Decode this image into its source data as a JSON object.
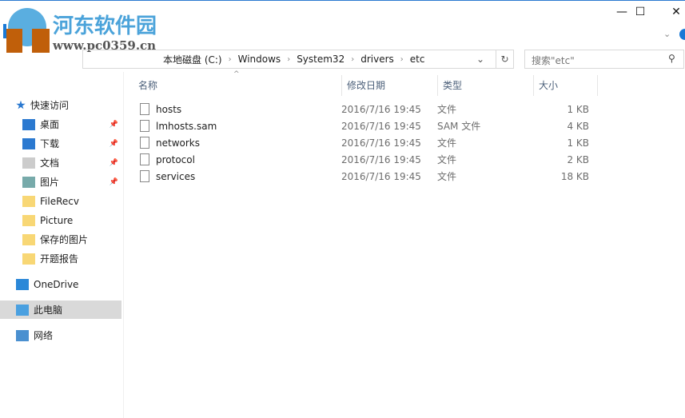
{
  "watermark": {
    "title": "河东软件园",
    "url": "www.pc0359.cn"
  },
  "window": {
    "minimize": "—",
    "maximize": "☐",
    "close": "✕"
  },
  "address": {
    "crumbs": [
      "本地磁盘 (C:)",
      "Windows",
      "System32",
      "drivers",
      "etc"
    ]
  },
  "search": {
    "placeholder": "搜索\"etc\""
  },
  "nav": {
    "items": [
      {
        "label": "快速访问",
        "icon": "star-icon"
      },
      {
        "label": "桌面",
        "icon": "desktop-icon",
        "pinned": true
      },
      {
        "label": "下载",
        "icon": "download-icon",
        "pinned": true
      },
      {
        "label": "文档",
        "icon": "document-icon",
        "pinned": true
      },
      {
        "label": "图片",
        "icon": "picture-icon",
        "pinned": true
      },
      {
        "label": "FileRecv",
        "icon": "folder-icon"
      },
      {
        "label": "Picture",
        "icon": "folder-icon"
      },
      {
        "label": "保存的图片",
        "icon": "folder-icon"
      },
      {
        "label": "开题报告",
        "icon": "folder-icon"
      },
      {
        "label": "OneDrive",
        "icon": "cloud-icon"
      },
      {
        "label": "此电脑",
        "icon": "computer-icon",
        "selected": true
      },
      {
        "label": "网络",
        "icon": "network-icon"
      }
    ]
  },
  "columns": {
    "name": "名称",
    "date": "修改日期",
    "type": "类型",
    "size": "大小"
  },
  "files": [
    {
      "name": "hosts",
      "date": "2016/7/16 19:45",
      "type": "文件",
      "size": "1 KB"
    },
    {
      "name": "lmhosts.sam",
      "date": "2016/7/16 19:45",
      "type": "SAM 文件",
      "size": "4 KB"
    },
    {
      "name": "networks",
      "date": "2016/7/16 19:45",
      "type": "文件",
      "size": "1 KB"
    },
    {
      "name": "protocol",
      "date": "2016/7/16 19:45",
      "type": "文件",
      "size": "2 KB"
    },
    {
      "name": "services",
      "date": "2016/7/16 19:45",
      "type": "文件",
      "size": "18 KB"
    }
  ]
}
